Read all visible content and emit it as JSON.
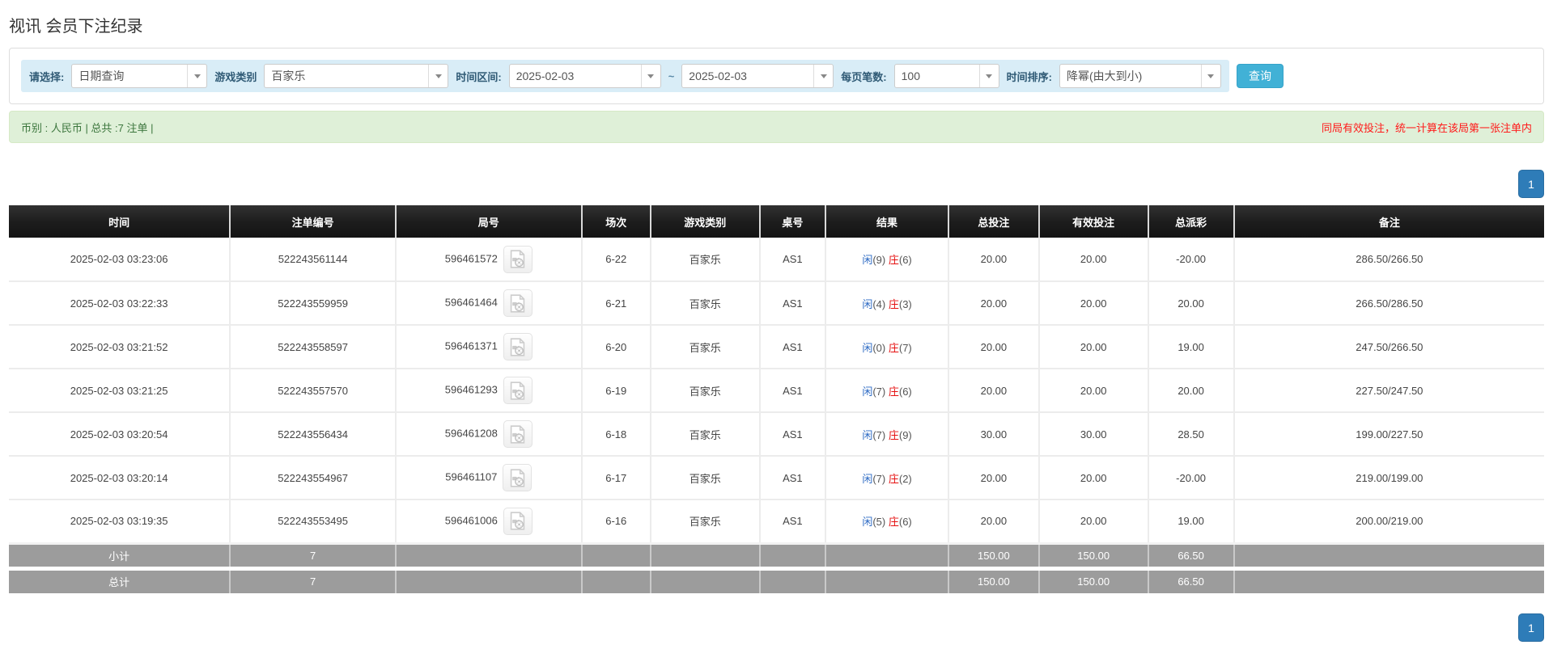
{
  "page": {
    "title": "视讯 会员下注纪录"
  },
  "filters": {
    "query_type": {
      "label": "请选择:",
      "value": "日期查询"
    },
    "game_category": {
      "label": "游戏类别",
      "value": "百家乐"
    },
    "time_range": {
      "label": "时间区间:",
      "from": "2025-02-03",
      "separator": "~",
      "to": "2025-02-03"
    },
    "page_size": {
      "label": "每页笔数:",
      "value": "100"
    },
    "time_sort": {
      "label": "时间排序:",
      "value": "降幂(由大到小)"
    },
    "search_button": "查询"
  },
  "summary_bar": {
    "left": "币别 : 人民币 | 总共 :7 注单 |",
    "right": "同局有效投注，统一计算在该局第一张注单内"
  },
  "pagination": {
    "page": "1"
  },
  "colors": {
    "accent_blue": "#2e7cb8",
    "search_teal": "#41b1d6",
    "player_blue": "#2e6bc4",
    "banker_red": "#e50f0f",
    "negative_red": "#e60c0c",
    "bet_blue": "#2577d4"
  },
  "table": {
    "headers": [
      "时间",
      "注单编号",
      "局号",
      "场次",
      "游戏类别",
      "桌号",
      "结果",
      "总投注",
      "有效投注",
      "总派彩",
      "备注"
    ],
    "video_icon_name": "video-file-icon",
    "rows": [
      {
        "time": "2025-02-03 03:23:06",
        "bet_id": "522243561144",
        "round_id": "596461572",
        "session": "6-22",
        "game": "百家乐",
        "table_no": "AS1",
        "player_label": "闲",
        "player_score": "(9)",
        "banker_label": "庄",
        "banker_score": "(6)",
        "total_bet": "20.00",
        "valid_bet": "20.00",
        "payout": "-20.00",
        "note": "286.50/266.50"
      },
      {
        "time": "2025-02-03 03:22:33",
        "bet_id": "522243559959",
        "round_id": "596461464",
        "session": "6-21",
        "game": "百家乐",
        "table_no": "AS1",
        "player_label": "闲",
        "player_score": "(4)",
        "banker_label": "庄",
        "banker_score": "(3)",
        "total_bet": "20.00",
        "valid_bet": "20.00",
        "payout": "20.00",
        "note": "266.50/286.50"
      },
      {
        "time": "2025-02-03 03:21:52",
        "bet_id": "522243558597",
        "round_id": "596461371",
        "session": "6-20",
        "game": "百家乐",
        "table_no": "AS1",
        "player_label": "闲",
        "player_score": "(0)",
        "banker_label": "庄",
        "banker_score": "(7)",
        "total_bet": "20.00",
        "valid_bet": "20.00",
        "payout": "19.00",
        "note": "247.50/266.50"
      },
      {
        "time": "2025-02-03 03:21:25",
        "bet_id": "522243557570",
        "round_id": "596461293",
        "session": "6-19",
        "game": "百家乐",
        "table_no": "AS1",
        "player_label": "闲",
        "player_score": "(7)",
        "banker_label": "庄",
        "banker_score": "(6)",
        "total_bet": "20.00",
        "valid_bet": "20.00",
        "payout": "20.00",
        "note": "227.50/247.50"
      },
      {
        "time": "2025-02-03 03:20:54",
        "bet_id": "522243556434",
        "round_id": "596461208",
        "session": "6-18",
        "game": "百家乐",
        "table_no": "AS1",
        "player_label": "闲",
        "player_score": "(7)",
        "banker_label": "庄",
        "banker_score": "(9)",
        "total_bet": "30.00",
        "valid_bet": "30.00",
        "payout": "28.50",
        "note": "199.00/227.50"
      },
      {
        "time": "2025-02-03 03:20:14",
        "bet_id": "522243554967",
        "round_id": "596461107",
        "session": "6-17",
        "game": "百家乐",
        "table_no": "AS1",
        "player_label": "闲",
        "player_score": "(7)",
        "banker_label": "庄",
        "banker_score": "(2)",
        "total_bet": "20.00",
        "valid_bet": "20.00",
        "payout": "-20.00",
        "note": "219.00/199.00"
      },
      {
        "time": "2025-02-03 03:19:35",
        "bet_id": "522243553495",
        "round_id": "596461006",
        "session": "6-16",
        "game": "百家乐",
        "table_no": "AS1",
        "player_label": "闲",
        "player_score": "(5)",
        "banker_label": "庄",
        "banker_score": "(6)",
        "total_bet": "20.00",
        "valid_bet": "20.00",
        "payout": "19.00",
        "note": "200.00/219.00"
      }
    ],
    "subtotal": {
      "label": "小计",
      "count": "7",
      "total_bet": "150.00",
      "valid_bet": "150.00",
      "payout": "66.50"
    },
    "total": {
      "label": "总计",
      "count": "7",
      "total_bet": "150.00",
      "valid_bet": "150.00",
      "payout": "66.50"
    }
  }
}
